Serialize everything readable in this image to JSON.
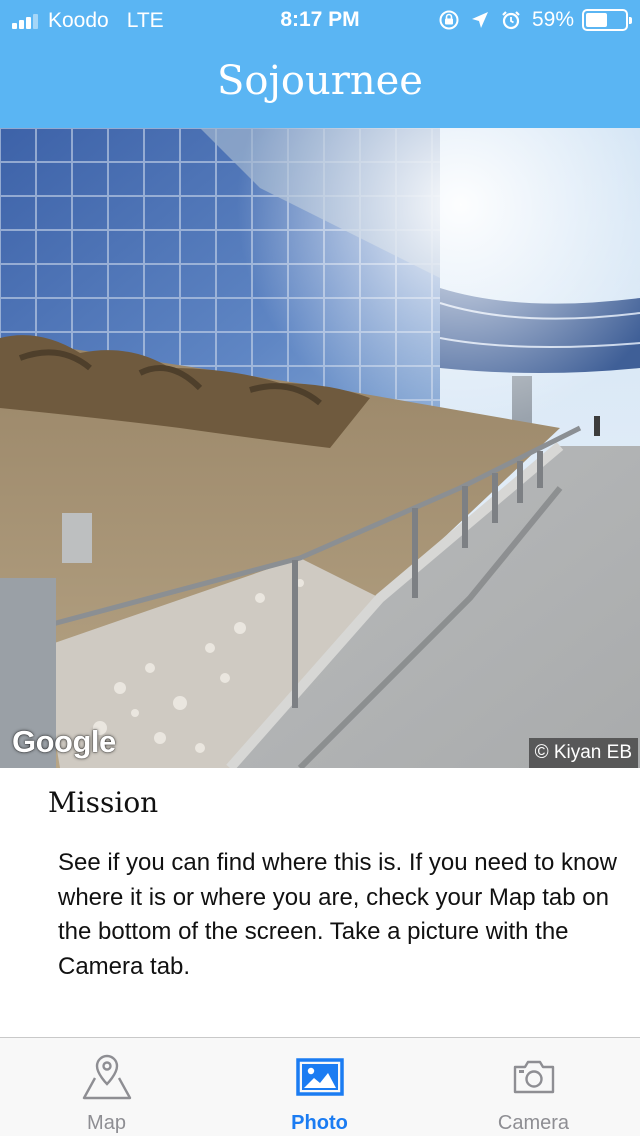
{
  "status_bar": {
    "carrier": "Koodo",
    "network": "LTE",
    "time": "8:17 PM",
    "battery": "59%",
    "battery_level": 0.59,
    "icons": [
      "signal-icon",
      "rotation-lock-icon",
      "location-arrow-icon",
      "alarm-icon",
      "battery-icon"
    ]
  },
  "nav": {
    "title": "Sojournee"
  },
  "photo": {
    "logo": "Google",
    "credit": "© Kiyan EB"
  },
  "mission": {
    "heading": "Mission",
    "text": "See if you can find where this is. If you need to know where it is or where you are, check your Map tab on the bottom of the screen. Take a picture with the Camera tab."
  },
  "tabs": [
    {
      "label": "Map",
      "icon": "map-pin-icon",
      "active": false
    },
    {
      "label": "Photo",
      "icon": "photo-icon",
      "active": true
    },
    {
      "label": "Camera",
      "icon": "camera-icon",
      "active": false
    }
  ],
  "colors": {
    "header": "#5ab5f3",
    "active_tab": "#1b7cf2",
    "inactive_tab": "#8e8e93"
  }
}
